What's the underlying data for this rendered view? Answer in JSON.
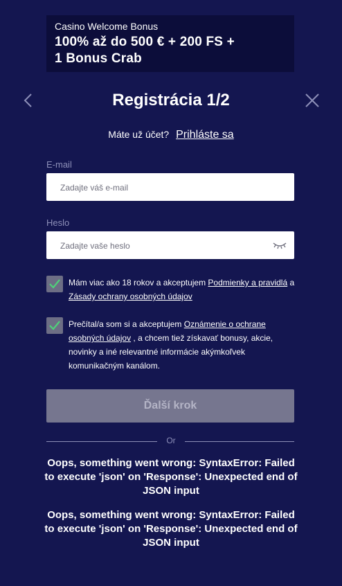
{
  "bonus": {
    "subtitle": "Casino Welcome Bonus",
    "title_line1": "100% až do 500 € + 200 FS +",
    "title_line2": "1 Bonus Crab"
  },
  "header": {
    "title": "Registrácia 1/2",
    "back_icon": "chevron-left-icon",
    "close_icon": "close-icon"
  },
  "account": {
    "prompt": "Máte už účet?",
    "login_link": "Prihláste sa"
  },
  "form": {
    "email_label": "E-mail",
    "email_placeholder": "Zadajte váš e-mail",
    "email_value": "",
    "password_label": "Heslo",
    "password_placeholder": "Zadajte vaše heslo",
    "password_value": "",
    "eye_icon": "eye-closed-icon"
  },
  "consents": [
    {
      "checked": true,
      "text_before": "Mám viac ako 18 rokov a akceptujem ",
      "link1": "Podmienky a pravidlá",
      "text_middle": " a ",
      "link2": "Zásady ochrany osobných údajov",
      "text_after": ""
    },
    {
      "checked": true,
      "text_before": "Prečítal/a som si a akceptujem ",
      "link1": "Oznámenie o ochrane osobných údajov",
      "text_after": " , a chcem tiež získavať bonusy, akcie, novinky a iné relevantné informácie akýmkoľvek komunikačným kanálom."
    }
  ],
  "next_button": "Ďalší krok",
  "divider_text": "Or",
  "errors": [
    "Oops, something went wrong: SyntaxError: Failed to execute 'json' on 'Response': Unexpected end of JSON input",
    "Oops, something went wrong: SyntaxError: Failed to execute 'json' on 'Response': Unexpected end of JSON input"
  ],
  "colors": {
    "background": "#141650",
    "bonus_banner": "#0c0d3a",
    "checkbox": "#6d6e85",
    "checkmark": "#4fd17a",
    "button_disabled": "#76768f"
  }
}
